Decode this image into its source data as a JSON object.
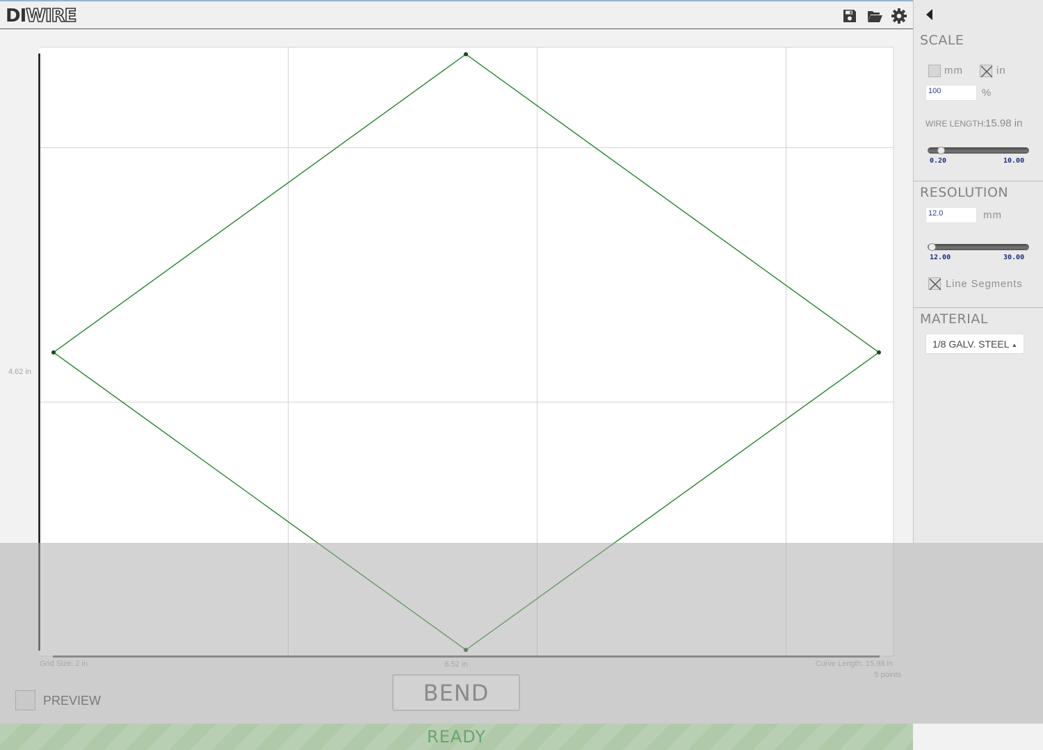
{
  "app": {
    "logo_solid": "DI",
    "logo_outline": "WIRE"
  },
  "toolbar": {
    "icons": [
      "save-icon",
      "folder-open-icon",
      "gear-icon"
    ]
  },
  "panel": {
    "collapse_icon": "caret-left-icon",
    "scale": {
      "title": "SCALE",
      "unit_mm_label": "mm",
      "unit_mm_checked": false,
      "unit_in_label": "in",
      "unit_in_checked": true,
      "percent_value": "100",
      "percent_unit": "%",
      "wire_length_label": "WIRE LENGTH:",
      "wire_length_value": "15.98 in",
      "slider_min": "0.20",
      "slider_max": "10.00",
      "slider_fraction": 0.1
    },
    "resolution": {
      "title": "RESOLUTION",
      "value": "12.0",
      "unit": "mm",
      "slider_min": "12.00",
      "slider_max": "30.00",
      "slider_fraction": 0.0,
      "line_segments_label": "Line Segments",
      "line_segments_checked": true
    },
    "material": {
      "title": "MATERIAL",
      "selected": "1/8 GALV. STEEL"
    }
  },
  "canvas": {
    "grid_size": "Grid Size: 2 in",
    "width_label": "6.52 in",
    "height_label": "4.62 in",
    "curve_length": "Curve Length: 15.98 in",
    "points_count": "5 points",
    "wire_color": "#1a7a1a"
  },
  "controls": {
    "preview_label": "PREVIEW",
    "preview_checked": false,
    "bend_label": "BEND"
  },
  "status": {
    "text": "READY",
    "color": "#6aa56a"
  }
}
